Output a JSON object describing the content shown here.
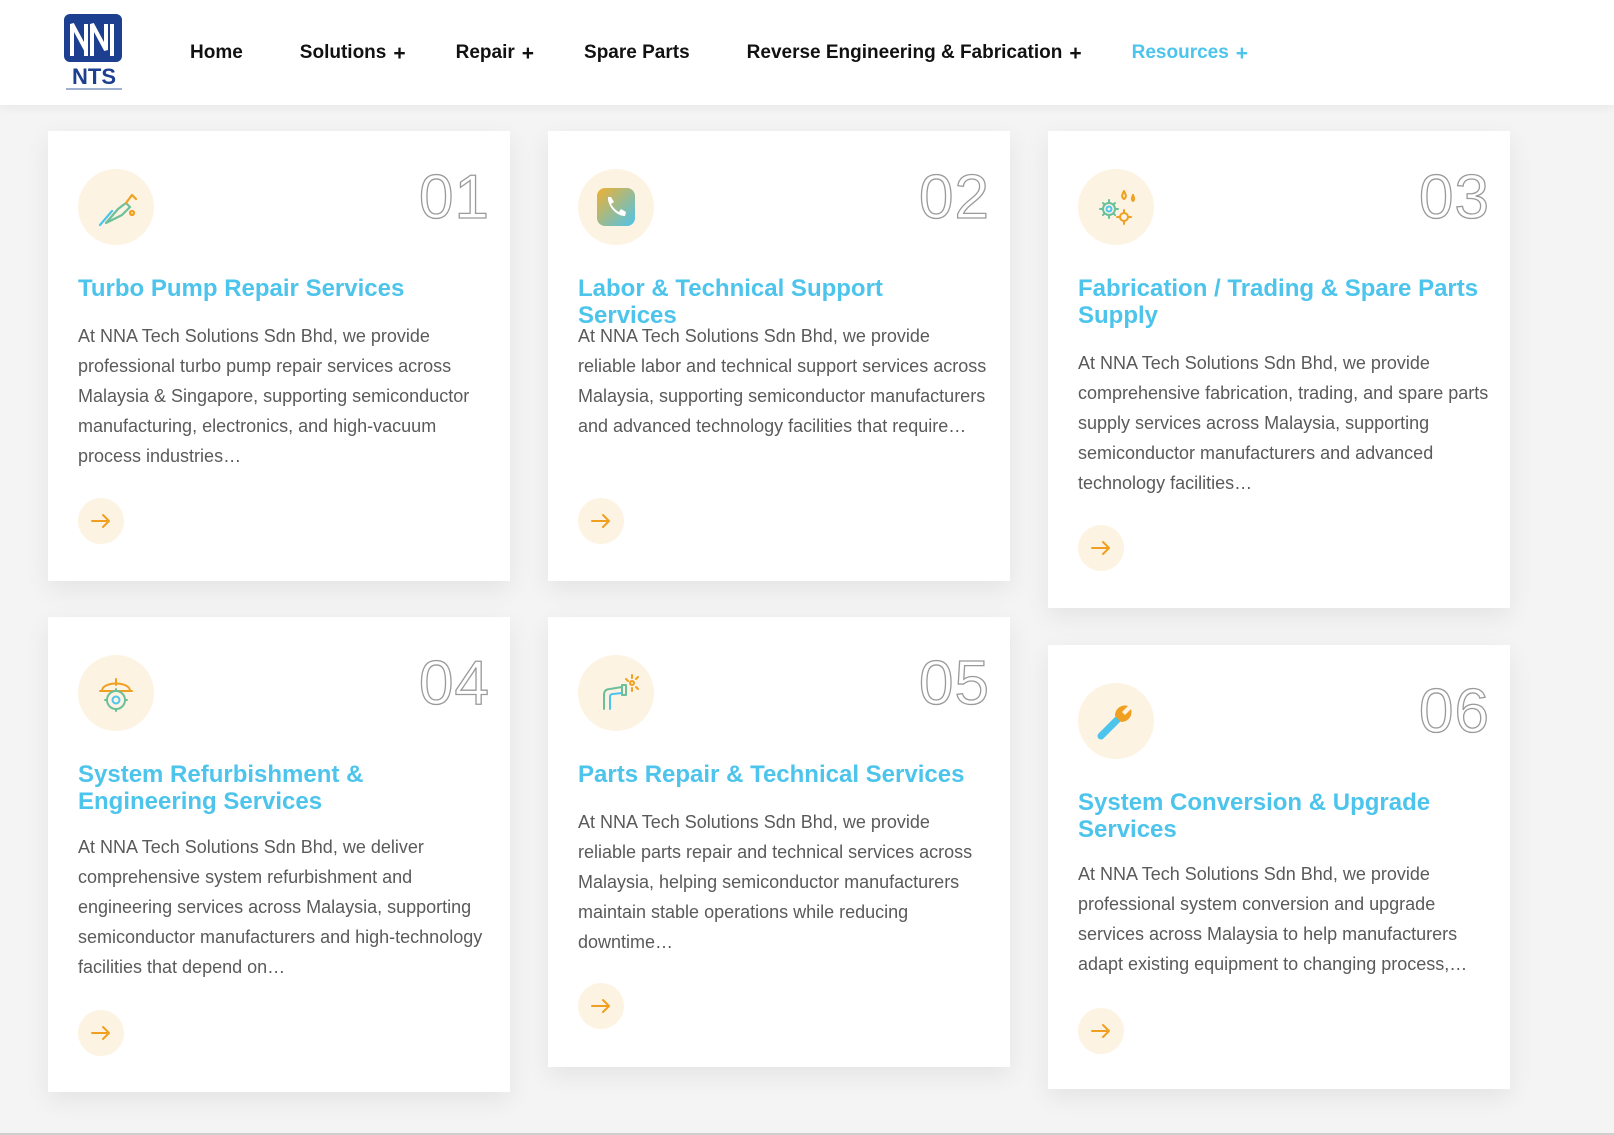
{
  "header": {
    "logo_text": "NTS",
    "nav": [
      {
        "label": "Home",
        "plus": ""
      },
      {
        "label": "Solutions",
        "plus": "+"
      },
      {
        "label": "Repair",
        "plus": "+"
      },
      {
        "label": "Spare Parts",
        "plus": ""
      },
      {
        "label": "Reverse Engineering & Fabrication",
        "plus": "+"
      },
      {
        "label": "Resources",
        "plus": "+"
      }
    ]
  },
  "colors": {
    "accent": "#4cc4ec",
    "icon_bg": "#fdf3e2",
    "arrow": "#f0a020"
  },
  "cards": [
    {
      "number": "01",
      "icon": "fuel-nozzle-icon",
      "title": "Turbo Pump Repair Services",
      "desc": "At NNA Tech Solutions Sdn Bhd, we provide professional turbo pump repair services across Malaysia & Singapore, supporting semiconductor manufacturing, electronics, and high-vacuum process industries…"
    },
    {
      "number": "02",
      "icon": "phone-icon",
      "title": "Labor & Technical Support Services",
      "desc": "At NNA Tech Solutions Sdn Bhd, we provide reliable labor and technical support services across Malaysia, supporting semiconductor manufacturers and advanced technology facilities that require…"
    },
    {
      "number": "03",
      "icon": "gears-oil-icon",
      "title": "Fabrication / Trading & Spare Parts Supply",
      "desc": "At NNA Tech Solutions Sdn Bhd, we provide comprehensive fabrication, trading, and spare parts supply services across Malaysia, supporting semiconductor manufacturers and advanced technology facilities…"
    },
    {
      "number": "04",
      "icon": "engineer-helmet-icon",
      "title": "System Refurbishment & Engineering Services",
      "desc": "At NNA Tech Solutions Sdn Bhd, we deliver comprehensive system refurbishment and engineering services across Malaysia, supporting semiconductor manufacturers and high-technology facilities that depend on…"
    },
    {
      "number": "05",
      "icon": "welding-torch-icon",
      "title": "Parts Repair & Technical Services",
      "desc": "At NNA Tech Solutions Sdn Bhd, we provide reliable parts repair and technical services across Malaysia, helping semiconductor manufacturers maintain stable operations while reducing downtime…"
    },
    {
      "number": "06",
      "icon": "wrench-icon",
      "title": "System Conversion & Upgrade Services",
      "desc": "At NNA Tech Solutions Sdn Bhd, we provide professional system conversion and upgrade services across Malaysia to help manufacturers adapt existing equipment to changing process,…"
    }
  ]
}
